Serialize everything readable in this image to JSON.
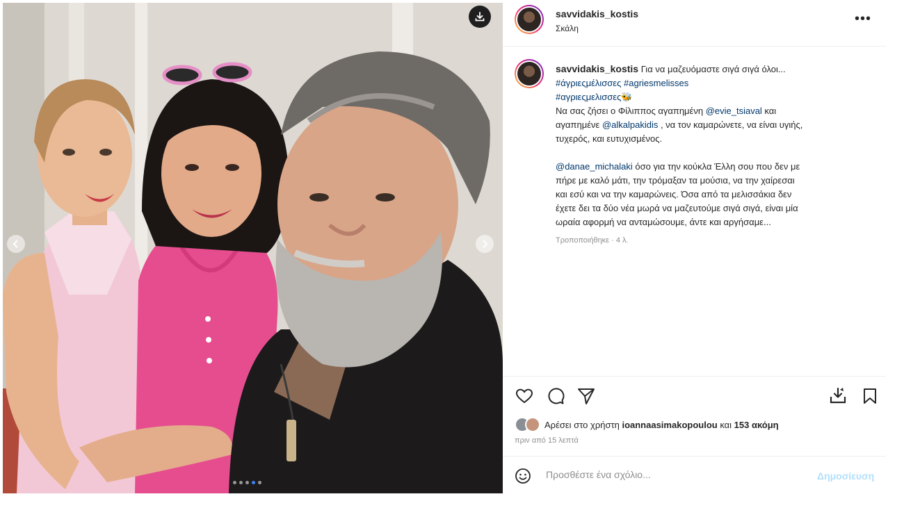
{
  "post": {
    "username": "savvidakis_kostis",
    "location": "Σκάλη",
    "more_label": "•••",
    "photo_dots": [
      false,
      false,
      false,
      true,
      false
    ],
    "caption": {
      "username": "savvidakis_kostis",
      "line1_text": " Για να μαζευόμαστε σιγά σιγά όλοι...",
      "hashtag1": "#άγριεςμέλισσες",
      "hashtag2": "#agriesmelisses",
      "hashtag3": "#αγριεςμελισσες",
      "emoji1": "🐝",
      "line3_a": "Να σας ζήσει ο Φίλιππος αγαπημένη ",
      "mention1": "@evie_tsiaval",
      "line3_b": " και",
      "line4_a": "αγαπημένε ",
      "mention2": "@alkalpakidis",
      "line4_b": " , να τον καμαρώνετε, να είναι υγιής,",
      "line5": "τυχερός, και ευτυχισμένος.",
      "mention3": "@danae_michalaki",
      "line6_b": " όσο για την κούκλα Έλλη σου που δεν με",
      "line7": "πήρε με καλό μάτι, την τρόμαξαν τα μούσια, να την χαίρεσαι",
      "line8": "και εσύ και να την καμαρώνεις. Όσα από τα μελισσάκια δεν",
      "line9": "έχετε δει τα δύο νέα μωρά να μαζευτούμε σιγά σιγά, είναι μία",
      "line10": "ωραία αφορμή να ανταμώσουμε, άντε και αργήσαμε...",
      "edited": "Τροποποιήθηκε · 4 λ."
    },
    "likes": {
      "prefix": "Αρέσει στο χρήστη ",
      "user": "ioannaasimakopoulou",
      "middle": " και ",
      "count": "153 ακόμη"
    },
    "time_ago": "πριν από 15 λεπτά",
    "comment": {
      "placeholder": "Προσθέστε ένα σχόλιο...",
      "post_label": "Δημοσίευση"
    }
  },
  "colors": {
    "link": "#00376b",
    "secondary_text": "#8e8e8e",
    "post_button_disabled": "#b2dffc"
  },
  "icons": [
    "download-icon",
    "chevron-left-icon",
    "chevron-right-icon",
    "more-icon",
    "heart-icon",
    "comment-icon",
    "share-icon",
    "save-to-collection-icon",
    "bookmark-icon",
    "emoji-icon"
  ]
}
